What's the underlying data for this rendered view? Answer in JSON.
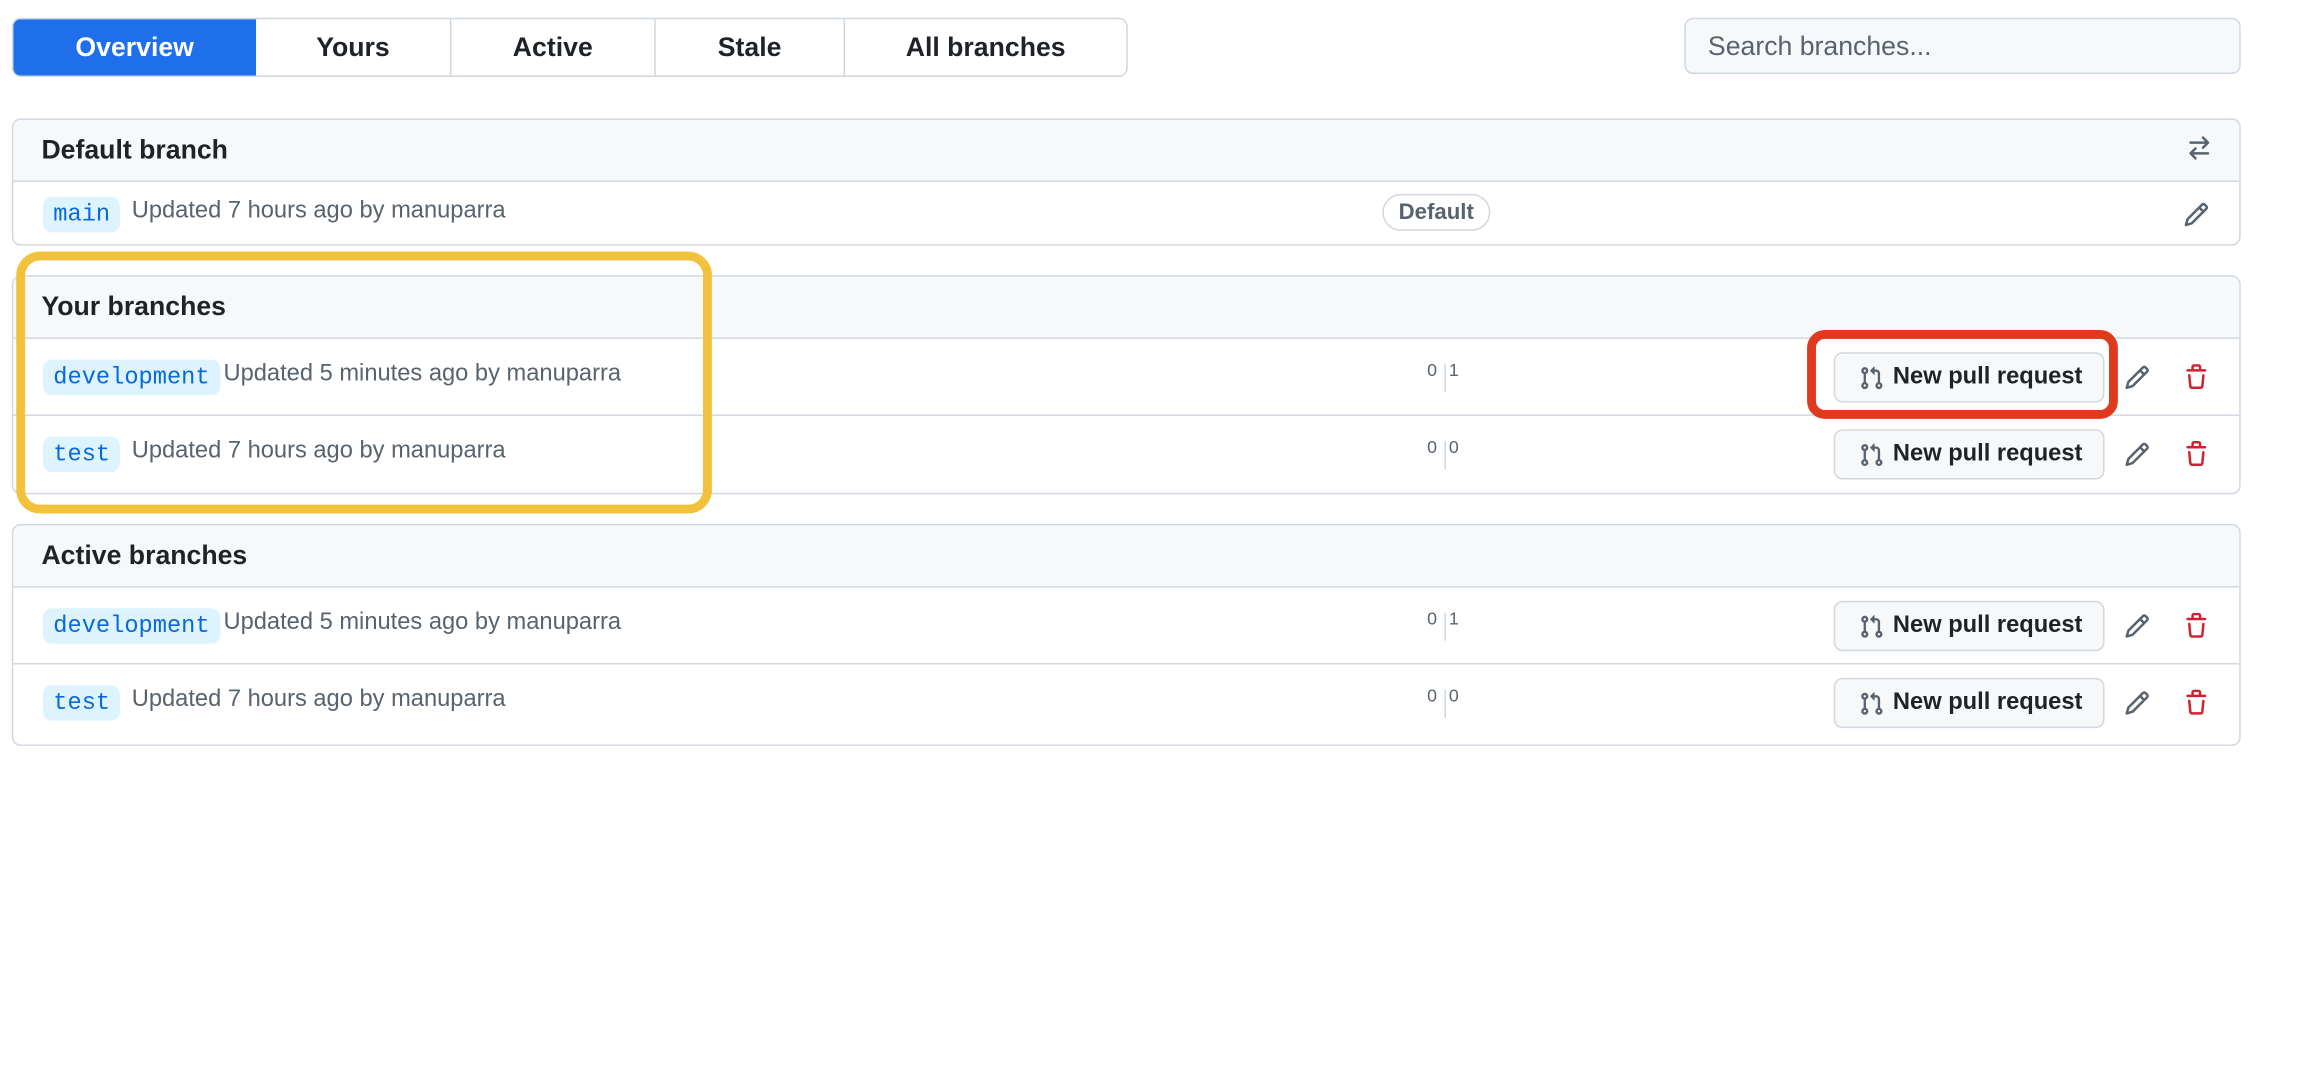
{
  "tabs": [
    {
      "label": "Overview",
      "selected": true
    },
    {
      "label": "Yours",
      "selected": false
    },
    {
      "label": "Active",
      "selected": false
    },
    {
      "label": "Stale",
      "selected": false
    },
    {
      "label": "All branches",
      "selected": false
    }
  ],
  "search": {
    "placeholder": "Search branches..."
  },
  "default_section": {
    "title": "Default branch",
    "row": {
      "branch": "main",
      "meta": "Updated 7 hours ago by manuparra",
      "badge": "Default"
    }
  },
  "your_section": {
    "title": "Your branches",
    "rows": [
      {
        "branch": "development",
        "meta": "Updated 5 minutes ago by manuparra",
        "behind": "0",
        "ahead": "1",
        "pr_label": "New pull request"
      },
      {
        "branch": "test",
        "meta": "Updated 7 hours ago by manuparra",
        "behind": "0",
        "ahead": "0",
        "pr_label": "New pull request"
      }
    ]
  },
  "active_section": {
    "title": "Active branches",
    "rows": [
      {
        "branch": "development",
        "meta": "Updated 5 minutes ago by manuparra",
        "behind": "0",
        "ahead": "1",
        "pr_label": "New pull request"
      },
      {
        "branch": "test",
        "meta": "Updated 7 hours ago by manuparra",
        "behind": "0",
        "ahead": "0",
        "pr_label": "New pull request"
      }
    ]
  },
  "colors": {
    "accent": "#1f6feb",
    "danger": "#cf222e",
    "highlight_yellow": "#f2c23d",
    "highlight_red": "#e03a1e"
  }
}
